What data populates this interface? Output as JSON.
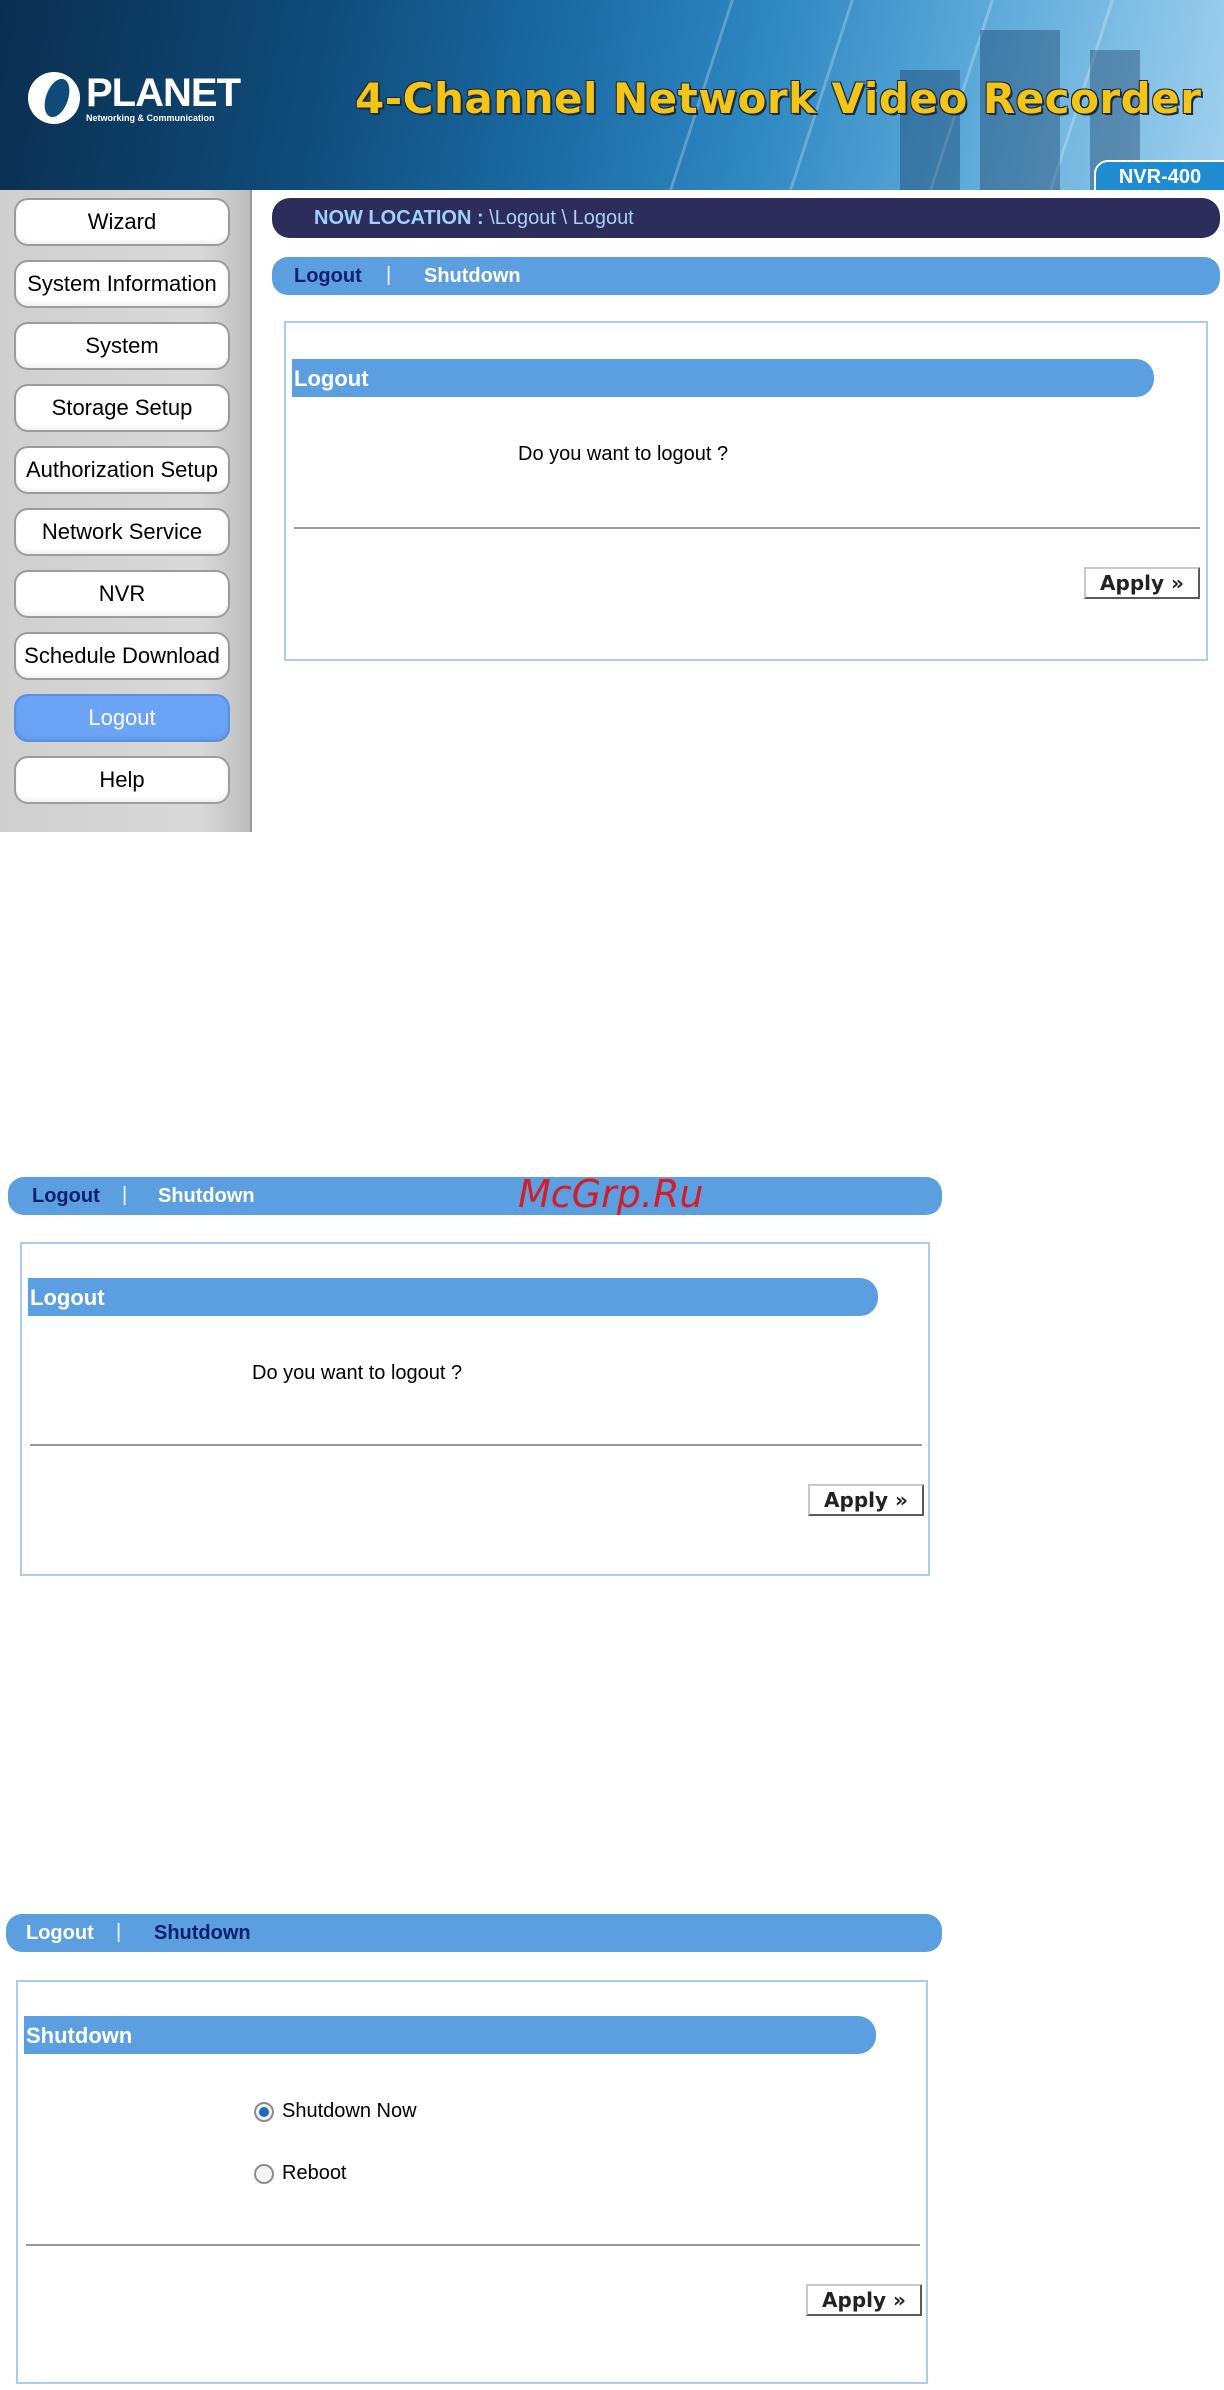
{
  "header": {
    "brand": "PLANET",
    "brand_tagline": "Networking & Communication",
    "title": "4-Channel Network Video Recorder",
    "model": "NVR-400"
  },
  "sidebar": {
    "items": [
      {
        "label": "Wizard"
      },
      {
        "label": "System Information"
      },
      {
        "label": "System"
      },
      {
        "label": "Storage Setup"
      },
      {
        "label": "Authorization Setup"
      },
      {
        "label": "Network Service"
      },
      {
        "label": "NVR"
      },
      {
        "label": "Schedule Download"
      },
      {
        "label": "Logout",
        "active": true
      },
      {
        "label": "Help"
      }
    ]
  },
  "location": {
    "label": "NOW LOCATION :",
    "path": "\\Logout \\ Logout"
  },
  "tabs": {
    "logout": "Logout",
    "separator": "|",
    "shutdown": "Shutdown"
  },
  "logout_section": {
    "heading": "Logout",
    "message": "Do you want to logout ?",
    "apply_label": "Apply »"
  },
  "shutdown_section": {
    "heading": "Shutdown",
    "options": [
      {
        "label": "Shutdown Now",
        "selected": true
      },
      {
        "label": "Reboot",
        "selected": false
      }
    ],
    "apply_label": "Apply »"
  },
  "watermark": "McGrp.Ru",
  "colors": {
    "accent_bar": "#5b9fe0",
    "location_bar": "#2c2d5a",
    "active_nav": "#6ba3f6",
    "title_yellow": "#f4c416"
  }
}
